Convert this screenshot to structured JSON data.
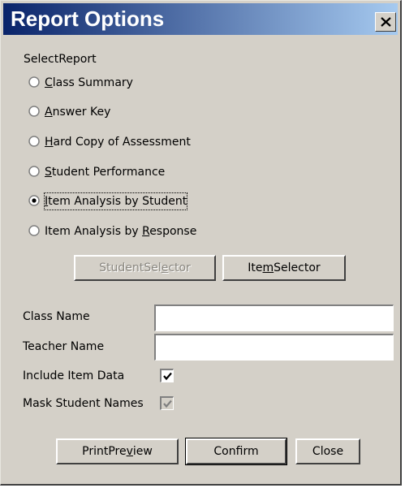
{
  "window": {
    "title": "Report Options",
    "close_glyph": "close-icon"
  },
  "report_group": {
    "label": "SelectReport",
    "options": [
      {
        "label_before": "",
        "label_u": "C",
        "label_after": "lass Summary",
        "selected": false
      },
      {
        "label_before": "",
        "label_u": "A",
        "label_after": "nswer Key",
        "selected": false
      },
      {
        "label_before": "",
        "label_u": "H",
        "label_after": "ard Copy of Assessment",
        "selected": false
      },
      {
        "label_before": "",
        "label_u": "S",
        "label_after": "tudent Performance",
        "selected": false
      },
      {
        "label_before": "",
        "label_u": "I",
        "label_after": "tem Analysis by Student",
        "selected": true
      },
      {
        "label_before": "Item Analysis by ",
        "label_u": "R",
        "label_after": "esponse",
        "selected": false
      }
    ]
  },
  "selectors": {
    "student": {
      "before": "StudentSel",
      "u": "e",
      "after": "ctor",
      "enabled": false
    },
    "item": {
      "before": "Ite",
      "u": "m",
      "after": "Selector",
      "enabled": true
    }
  },
  "fields": {
    "class_name": {
      "label": "Class Name",
      "value": ""
    },
    "teacher_name": {
      "label": "Teacher Name",
      "value": ""
    }
  },
  "checks": {
    "include_item_data": {
      "label": "Include Item Data",
      "checked": true,
      "enabled": true
    },
    "mask_student_names": {
      "label": "Mask Student Names",
      "checked": true,
      "enabled": false
    }
  },
  "footer": {
    "print_preview": {
      "before": "PrintPre",
      "u": "v",
      "after": "iew"
    },
    "confirm": "Confirm",
    "close": "Close"
  }
}
